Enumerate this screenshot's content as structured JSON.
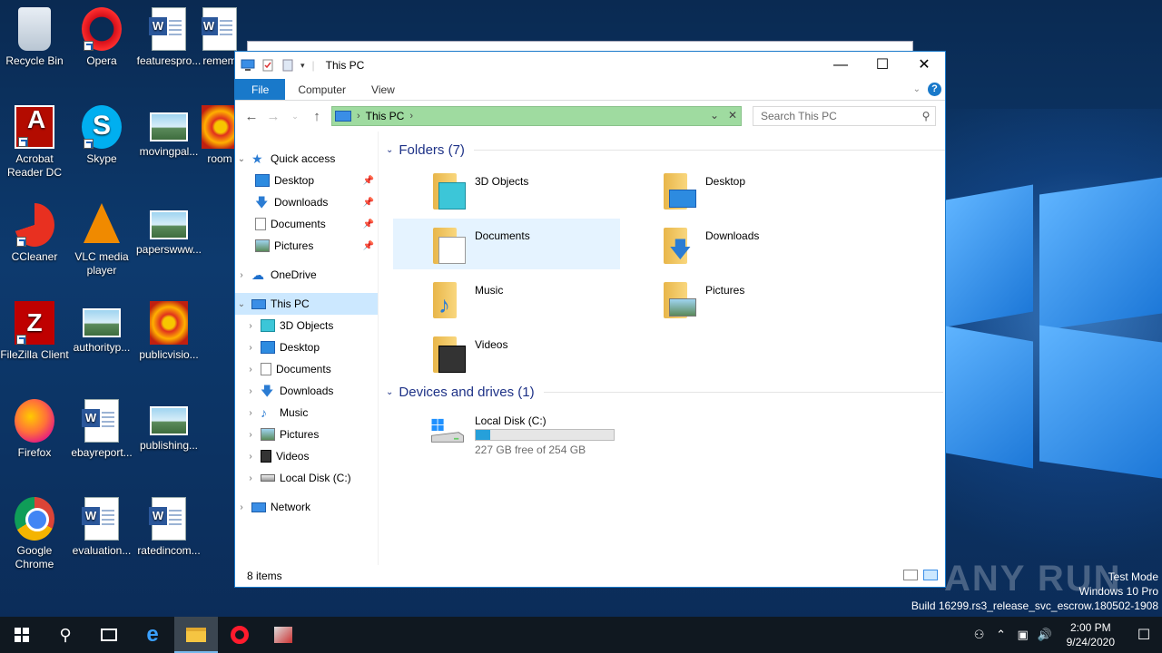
{
  "desktop": {
    "icons": [
      {
        "label": "Recycle Bin",
        "icon": "recycle-bin-icon"
      },
      {
        "label": "Opera",
        "icon": "opera-icon"
      },
      {
        "label": "featurespro...",
        "icon": "word-document-icon"
      },
      {
        "label": "remem",
        "icon": "word-document-icon"
      },
      {
        "label": "Acrobat Reader DC",
        "icon": "acrobat-icon"
      },
      {
        "label": "Skype",
        "icon": "skype-icon"
      },
      {
        "label": "movingpal...",
        "icon": "image-file-icon"
      },
      {
        "label": "room",
        "icon": "image-file-icon"
      },
      {
        "label": "CCleaner",
        "icon": "ccleaner-icon"
      },
      {
        "label": "VLC media player",
        "icon": "vlc-icon"
      },
      {
        "label": "paperswww...",
        "icon": "image-file-icon"
      },
      {
        "label": "FileZilla Client",
        "icon": "filezilla-icon"
      },
      {
        "label": "authorityp...",
        "icon": "image-file-icon"
      },
      {
        "label": "publicvisio...",
        "icon": "image-file-icon"
      },
      {
        "label": "Firefox",
        "icon": "firefox-icon"
      },
      {
        "label": "ebayreport...",
        "icon": "word-document-icon"
      },
      {
        "label": "publishing...",
        "icon": "image-file-icon"
      },
      {
        "label": "Google Chrome",
        "icon": "chrome-icon"
      },
      {
        "label": "evaluation...",
        "icon": "word-document-icon"
      },
      {
        "label": "ratedincom...",
        "icon": "word-document-icon"
      }
    ]
  },
  "explorer": {
    "title": "This PC",
    "ribbon_tabs": {
      "file": "File",
      "computer": "Computer",
      "view": "View"
    },
    "address": {
      "location": "This PC"
    },
    "search": {
      "placeholder": "Search This PC"
    },
    "nav": {
      "quick_access": "Quick access",
      "qa_desktop": "Desktop",
      "qa_downloads": "Downloads",
      "qa_documents": "Documents",
      "qa_pictures": "Pictures",
      "onedrive": "OneDrive",
      "this_pc": "This PC",
      "pc_3d": "3D Objects",
      "pc_desktop": "Desktop",
      "pc_documents": "Documents",
      "pc_downloads": "Downloads",
      "pc_music": "Music",
      "pc_pictures": "Pictures",
      "pc_videos": "Videos",
      "pc_localdisk": "Local Disk (C:)",
      "network": "Network"
    },
    "folders_header": "Folders (7)",
    "folders": {
      "f3d": "3D Objects",
      "desktop": "Desktop",
      "documents": "Documents",
      "downloads": "Downloads",
      "music": "Music",
      "pictures": "Pictures",
      "videos": "Videos"
    },
    "devices_header": "Devices and drives (1)",
    "drive": {
      "name": "Local Disk (C:)",
      "free_text": "227 GB free of 254 GB",
      "used_fraction": 0.106
    },
    "status": {
      "items": "8 items"
    }
  },
  "watermark": {
    "brand": "ANY RUN",
    "mode": "Test Mode",
    "edition": "Windows 10 Pro",
    "build": "Build 16299.rs3_release_svc_escrow.180502-1908"
  },
  "taskbar": {
    "time": "2:00 PM",
    "date": "9/24/2020"
  },
  "colors": {
    "accent": "#1979ca",
    "address_highlight": "#9fdba0",
    "selection": "#cce8ff",
    "drive_bar": "#26a0da"
  }
}
